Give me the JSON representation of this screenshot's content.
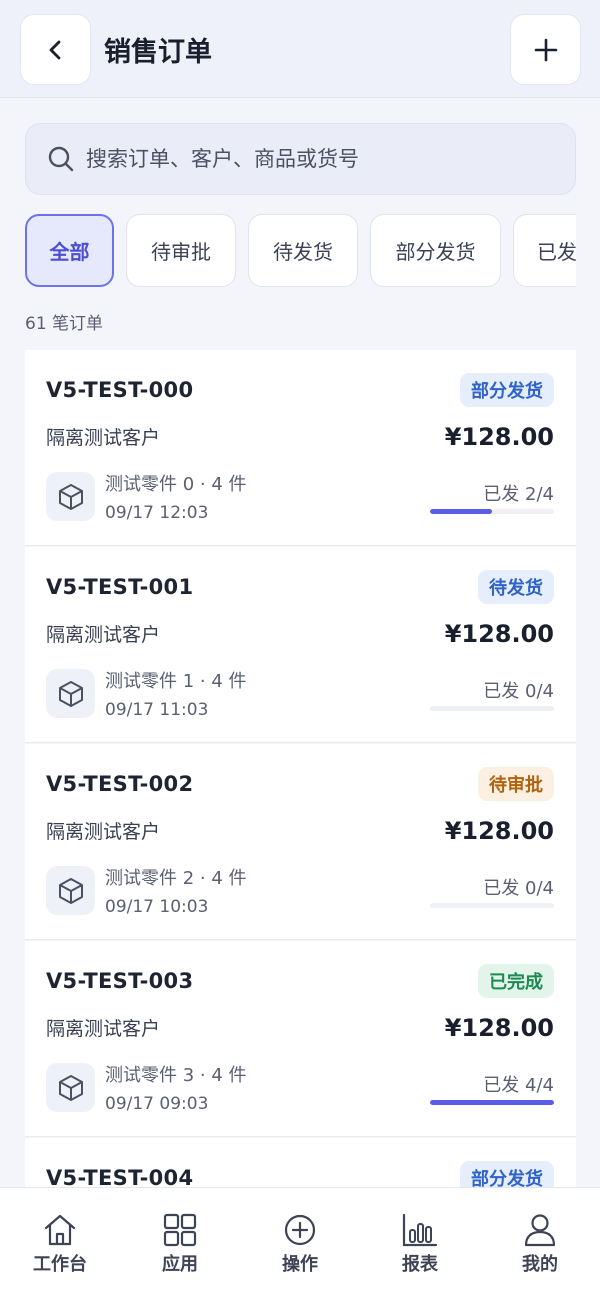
{
  "header": {
    "title": "销售订单"
  },
  "search": {
    "placeholder": "搜索订单、客户、商品或货号"
  },
  "filters": [
    {
      "label": "全部",
      "active": true
    },
    {
      "label": "待审批",
      "active": false
    },
    {
      "label": "待发货",
      "active": false
    },
    {
      "label": "部分发货",
      "active": false
    },
    {
      "label": "已发货",
      "active": false
    }
  ],
  "summary": {
    "count_text": "61 笔订单"
  },
  "orders": [
    {
      "id": "V5-TEST-000",
      "customer": "隔离测试客户",
      "status": "部分发货",
      "status_color": "#2f63c8",
      "status_bg": "#e6eefb",
      "amount": "¥128.00",
      "product": "测试零件 0 · 4 件",
      "time": "09/17 12:03",
      "shipped": "已发 2/4",
      "progress": 0.5
    },
    {
      "id": "V5-TEST-001",
      "customer": "隔离测试客户",
      "status": "待发货",
      "status_color": "#2f63c8",
      "status_bg": "#e6eefb",
      "amount": "¥128.00",
      "product": "测试零件 1 · 4 件",
      "time": "09/17 11:03",
      "shipped": "已发 0/4",
      "progress": 0
    },
    {
      "id": "V5-TEST-002",
      "customer": "隔离测试客户",
      "status": "待审批",
      "status_color": "#b0620f",
      "status_bg": "#fbf0e1",
      "amount": "¥128.00",
      "product": "测试零件 2 · 4 件",
      "time": "09/17 10:03",
      "shipped": "已发 0/4",
      "progress": 0
    },
    {
      "id": "V5-TEST-003",
      "customer": "隔离测试客户",
      "status": "已完成",
      "status_color": "#1d8a50",
      "status_bg": "#e3f5ea",
      "amount": "¥128.00",
      "product": "测试零件 3 · 4 件",
      "time": "09/17 09:03",
      "shipped": "已发 4/4",
      "progress": 1
    },
    {
      "id": "V5-TEST-004",
      "customer": "",
      "status": "部分发货",
      "status_color": "#2f63c8",
      "status_bg": "#e6eefb",
      "amount": "",
      "product": "",
      "time": "",
      "shipped": "",
      "progress": null
    }
  ],
  "tabbar": [
    {
      "label": "工作台",
      "icon": "home-icon"
    },
    {
      "label": "应用",
      "icon": "apps-grid-icon"
    },
    {
      "label": "操作",
      "icon": "plus-circle-icon"
    },
    {
      "label": "报表",
      "icon": "bar-chart-icon"
    },
    {
      "label": "我的",
      "icon": "user-icon"
    }
  ],
  "colors": {
    "accent": "#5a5ee6",
    "background": "#f3f5fb"
  }
}
